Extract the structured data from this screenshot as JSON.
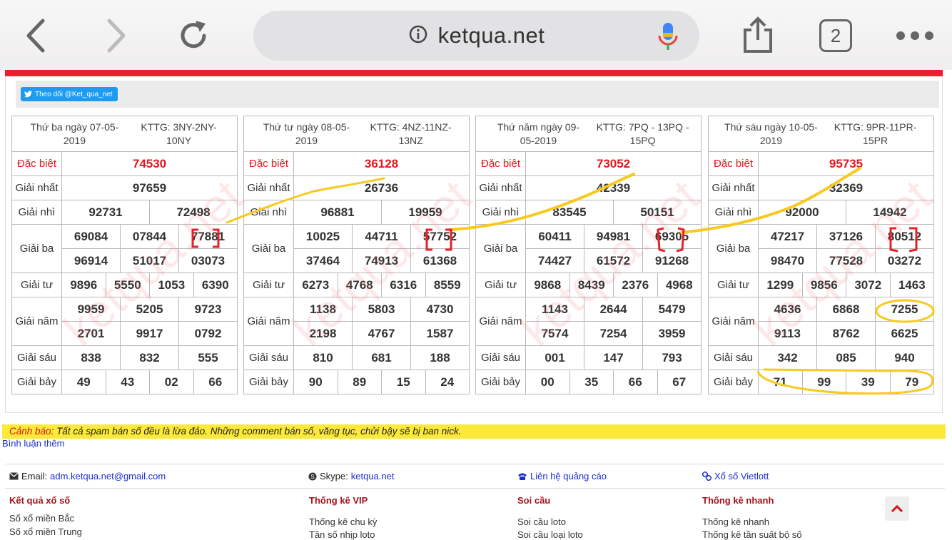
{
  "browser": {
    "url": "ketqua.net",
    "tab_count": "2",
    "icons": [
      "back-icon",
      "forward-icon",
      "reload-icon",
      "info-icon",
      "mic-icon",
      "share-icon",
      "more-icon"
    ]
  },
  "twitter_button": "Theo dõi @Ket_qua_net",
  "labels": {
    "db": "Đặc biệt",
    "g1": "Giải nhất",
    "g2": "Giải nhì",
    "g3": "Giải ba",
    "g4": "Giải tư",
    "g5": "Giải năm",
    "g6": "Giải sáu",
    "g7": "Giải bảy"
  },
  "results": [
    {
      "date": "Thứ ba ngày 07-05-2019",
      "kttg": "KTTG: 3NY-2NY-10NY",
      "db": "74530",
      "g1": "97659",
      "g2": [
        "92731",
        "72498"
      ],
      "g3": [
        "69084",
        "07844",
        "77881",
        "96914",
        "51017",
        "03073"
      ],
      "g4": [
        "9896",
        "5550",
        "1053",
        "6390"
      ],
      "g5": [
        "9959",
        "5205",
        "9723",
        "2701",
        "9917",
        "0792"
      ],
      "g6": [
        "838",
        "832",
        "555"
      ],
      "g7": [
        "49",
        "43",
        "02",
        "66"
      ]
    },
    {
      "date": "Thứ tư ngày 08-05-2019",
      "kttg": "KTTG: 4NZ-11NZ-13NZ",
      "db": "36128",
      "g1": "26736",
      "g2": [
        "96881",
        "19959"
      ],
      "g3": [
        "10025",
        "44711",
        "57752",
        "37464",
        "74913",
        "61368"
      ],
      "g4": [
        "6273",
        "4768",
        "6316",
        "8559"
      ],
      "g5": [
        "1138",
        "5803",
        "4730",
        "2198",
        "4767",
        "1587"
      ],
      "g6": [
        "810",
        "681",
        "188"
      ],
      "g7": [
        "90",
        "89",
        "15",
        "24"
      ]
    },
    {
      "date": "Thứ năm ngày 09-05-2019",
      "kttg": "KTTG: 7PQ - 13PQ - 15PQ",
      "db": "73052",
      "g1": "42339",
      "g2": [
        "83545",
        "50151"
      ],
      "g3": [
        "60411",
        "94981",
        "69305",
        "74427",
        "61572",
        "91268"
      ],
      "g4": [
        "9868",
        "8439",
        "2376",
        "4968"
      ],
      "g5": [
        "1143",
        "2644",
        "5479",
        "7574",
        "7254",
        "3959"
      ],
      "g6": [
        "001",
        "147",
        "793"
      ],
      "g7": [
        "00",
        "35",
        "66",
        "67"
      ]
    },
    {
      "date": "Thứ sáu ngày 10-05-2019",
      "kttg": "KTTG: 9PR-11PR-15PR",
      "db": "95735",
      "g1": "32369",
      "g2": [
        "92000",
        "14942"
      ],
      "g3": [
        "47217",
        "37126",
        "80512",
        "98470",
        "77528",
        "03272"
      ],
      "g4": [
        "1299",
        "9856",
        "3072",
        "1463"
      ],
      "g5": [
        "4636",
        "6868",
        "7255",
        "9113",
        "8762",
        "6625"
      ],
      "g6": [
        "342",
        "085",
        "940"
      ],
      "g7": [
        "71",
        "99",
        "39",
        "79"
      ]
    }
  ],
  "warning": {
    "label": "Cảnh báo",
    "text": ": Tất cả spam bán số đều là lừa đảo. Những comment bán số, văng tục, chửi bậy sẽ bị ban nick."
  },
  "more_comments": "Bình luận thêm",
  "footer": {
    "email_label": "Email:",
    "email": "adm.ketqua.net@gmail.com",
    "skype_label": "Skype:",
    "skype": "ketqua.net",
    "ads": "Liên hệ quảng cáo",
    "vietlott": "Xổ số Vietlott"
  },
  "columns": [
    {
      "title": "Kết quả xổ số",
      "links": [
        "Số xổ miền Bắc",
        "Số xổ miền Trung"
      ]
    },
    {
      "title": "Thống kê VIP",
      "links": [
        "Thống kê chu kỳ",
        "Tần số nhịp loto"
      ]
    },
    {
      "title": "Soi cầu",
      "links": [
        "Soi cầu loto",
        "Soi cầu loại loto"
      ]
    },
    {
      "title": "Thống kê nhanh",
      "links": [
        "Thống kê nhanh",
        "Thống kê tần suất bộ số"
      ]
    }
  ],
  "watermark": "ketqua.net",
  "colors": {
    "accent_red": "#e3161d",
    "warning_bg": "#fde93a",
    "link_blue": "#1a2fd1",
    "highlight_yellow": "#f8c91f"
  }
}
